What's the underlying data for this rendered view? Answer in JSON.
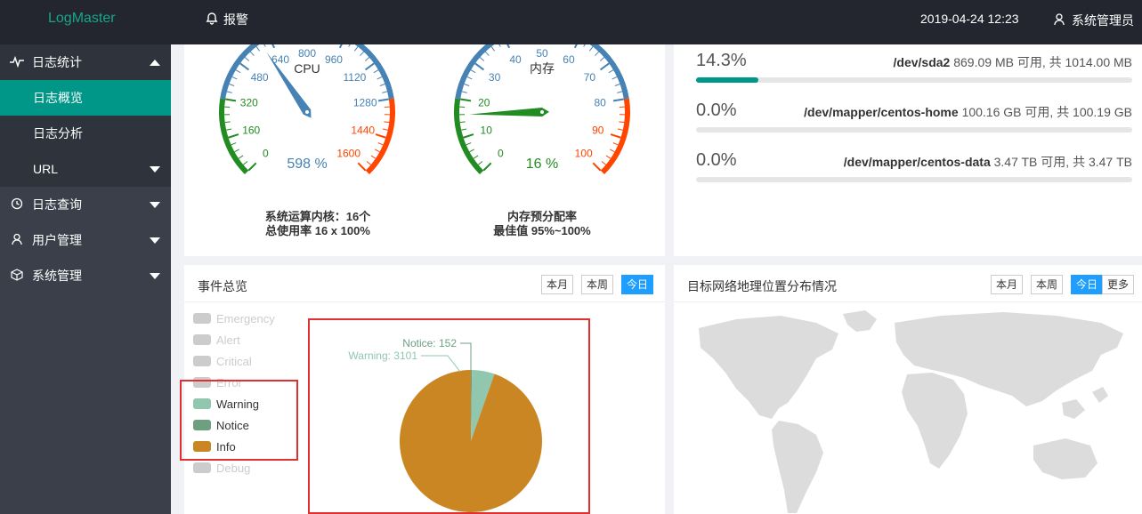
{
  "header": {
    "brand": "LogMaster",
    "alarm_label": "报警",
    "datetime": "2019-04-24 12:23",
    "user": "系统管理员"
  },
  "sidebar": {
    "groups": [
      {
        "label": "日志统计",
        "icon": "pulse-icon",
        "expanded": true,
        "items": [
          {
            "label": "日志概览",
            "active": true
          },
          {
            "label": "日志分析"
          },
          {
            "label": "URL"
          }
        ]
      },
      {
        "label": "日志查询",
        "icon": "clock-icon"
      },
      {
        "label": "用户管理",
        "icon": "user-icon"
      },
      {
        "label": "系统管理",
        "icon": "cube-icon"
      }
    ]
  },
  "gauges": {
    "cpu": {
      "name": "CPU",
      "value_text": "598 %",
      "value": 598,
      "min": 0,
      "max": 1600,
      "ticks": [
        "0",
        "160",
        "320",
        "480",
        "640",
        "800",
        "960",
        "1120",
        "1280",
        "1440",
        "1600"
      ],
      "caption_line1": "系统运算内核：16个",
      "caption_line2": "总使用率 16 x 100%"
    },
    "mem": {
      "name": "内存",
      "value_text": "16 %",
      "value": 16,
      "min": 0,
      "max": 100,
      "ticks": [
        "0",
        "10",
        "20",
        "30",
        "40",
        "50",
        "60",
        "70",
        "80",
        "90",
        "100"
      ],
      "caption_line1": "内存预分配率",
      "caption_line2": "最佳值 95%~100%"
    },
    "colors": {
      "low": "#228b22",
      "mid": "#4682b4",
      "high": "#ff4500"
    }
  },
  "disks": [
    {
      "pct": "14.3%",
      "fraction": 0.143,
      "device": "/dev/sda2",
      "detail": "869.09 MB 可用, 共 1014.00 MB"
    },
    {
      "pct": "0.0%",
      "fraction": 0,
      "device": "/dev/mapper/centos-home",
      "detail": "100.16 GB 可用, 共 100.19 GB"
    },
    {
      "pct": "0.0%",
      "fraction": 0,
      "device": "/dev/mapper/centos-data",
      "detail": "3.47 TB 可用, 共 3.47 TB"
    }
  ],
  "events": {
    "title": "事件总览",
    "buttons": [
      "本月",
      "本周",
      "今日"
    ],
    "legend": [
      {
        "name": "Emergency",
        "active": false
      },
      {
        "name": "Alert",
        "active": false
      },
      {
        "name": "Critical",
        "active": false
      },
      {
        "name": "Error",
        "active": false
      },
      {
        "name": "Warning",
        "active": true,
        "color": "#91c7ae"
      },
      {
        "name": "Notice",
        "active": true,
        "color": "#6e9f80"
      },
      {
        "name": "Info",
        "active": true,
        "color": "#ca8622"
      },
      {
        "name": "Debug",
        "active": false
      }
    ],
    "pie_labels": {
      "notice": "Notice: 152",
      "warning": "Warning: 3101"
    }
  },
  "chart_data": {
    "type": "pie",
    "title": "",
    "categories": [
      "Warning",
      "Notice",
      "Info"
    ],
    "values": [
      3101,
      152,
      57000
    ],
    "colors": [
      "#91c7ae",
      "#6e9f80",
      "#ca8622"
    ]
  },
  "geo": {
    "title": "目标网络地理位置分布情况",
    "buttons": [
      "本月",
      "本周",
      "今日",
      "更多"
    ]
  }
}
